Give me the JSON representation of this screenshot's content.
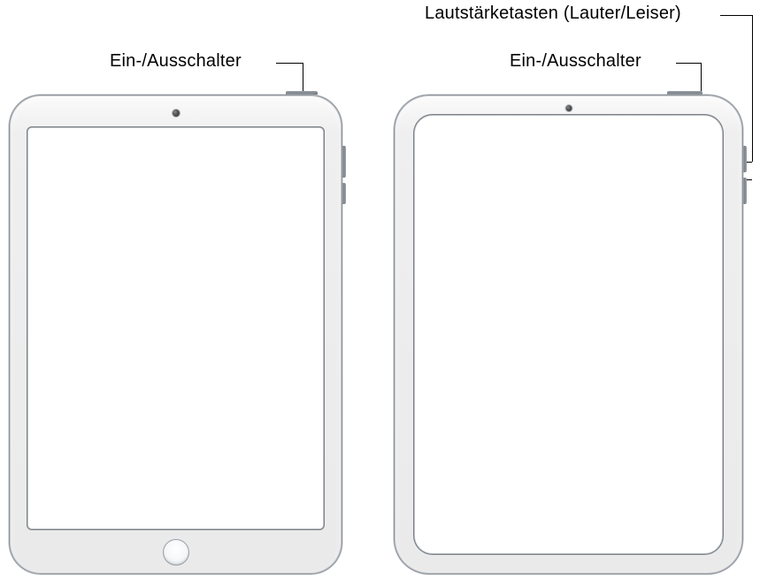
{
  "labels": {
    "left_power": "Ein-/Ausschalter",
    "right_power": "Ein-/Ausschalter",
    "volume": "Lautstärketasten (Lauter/Leiser)"
  }
}
